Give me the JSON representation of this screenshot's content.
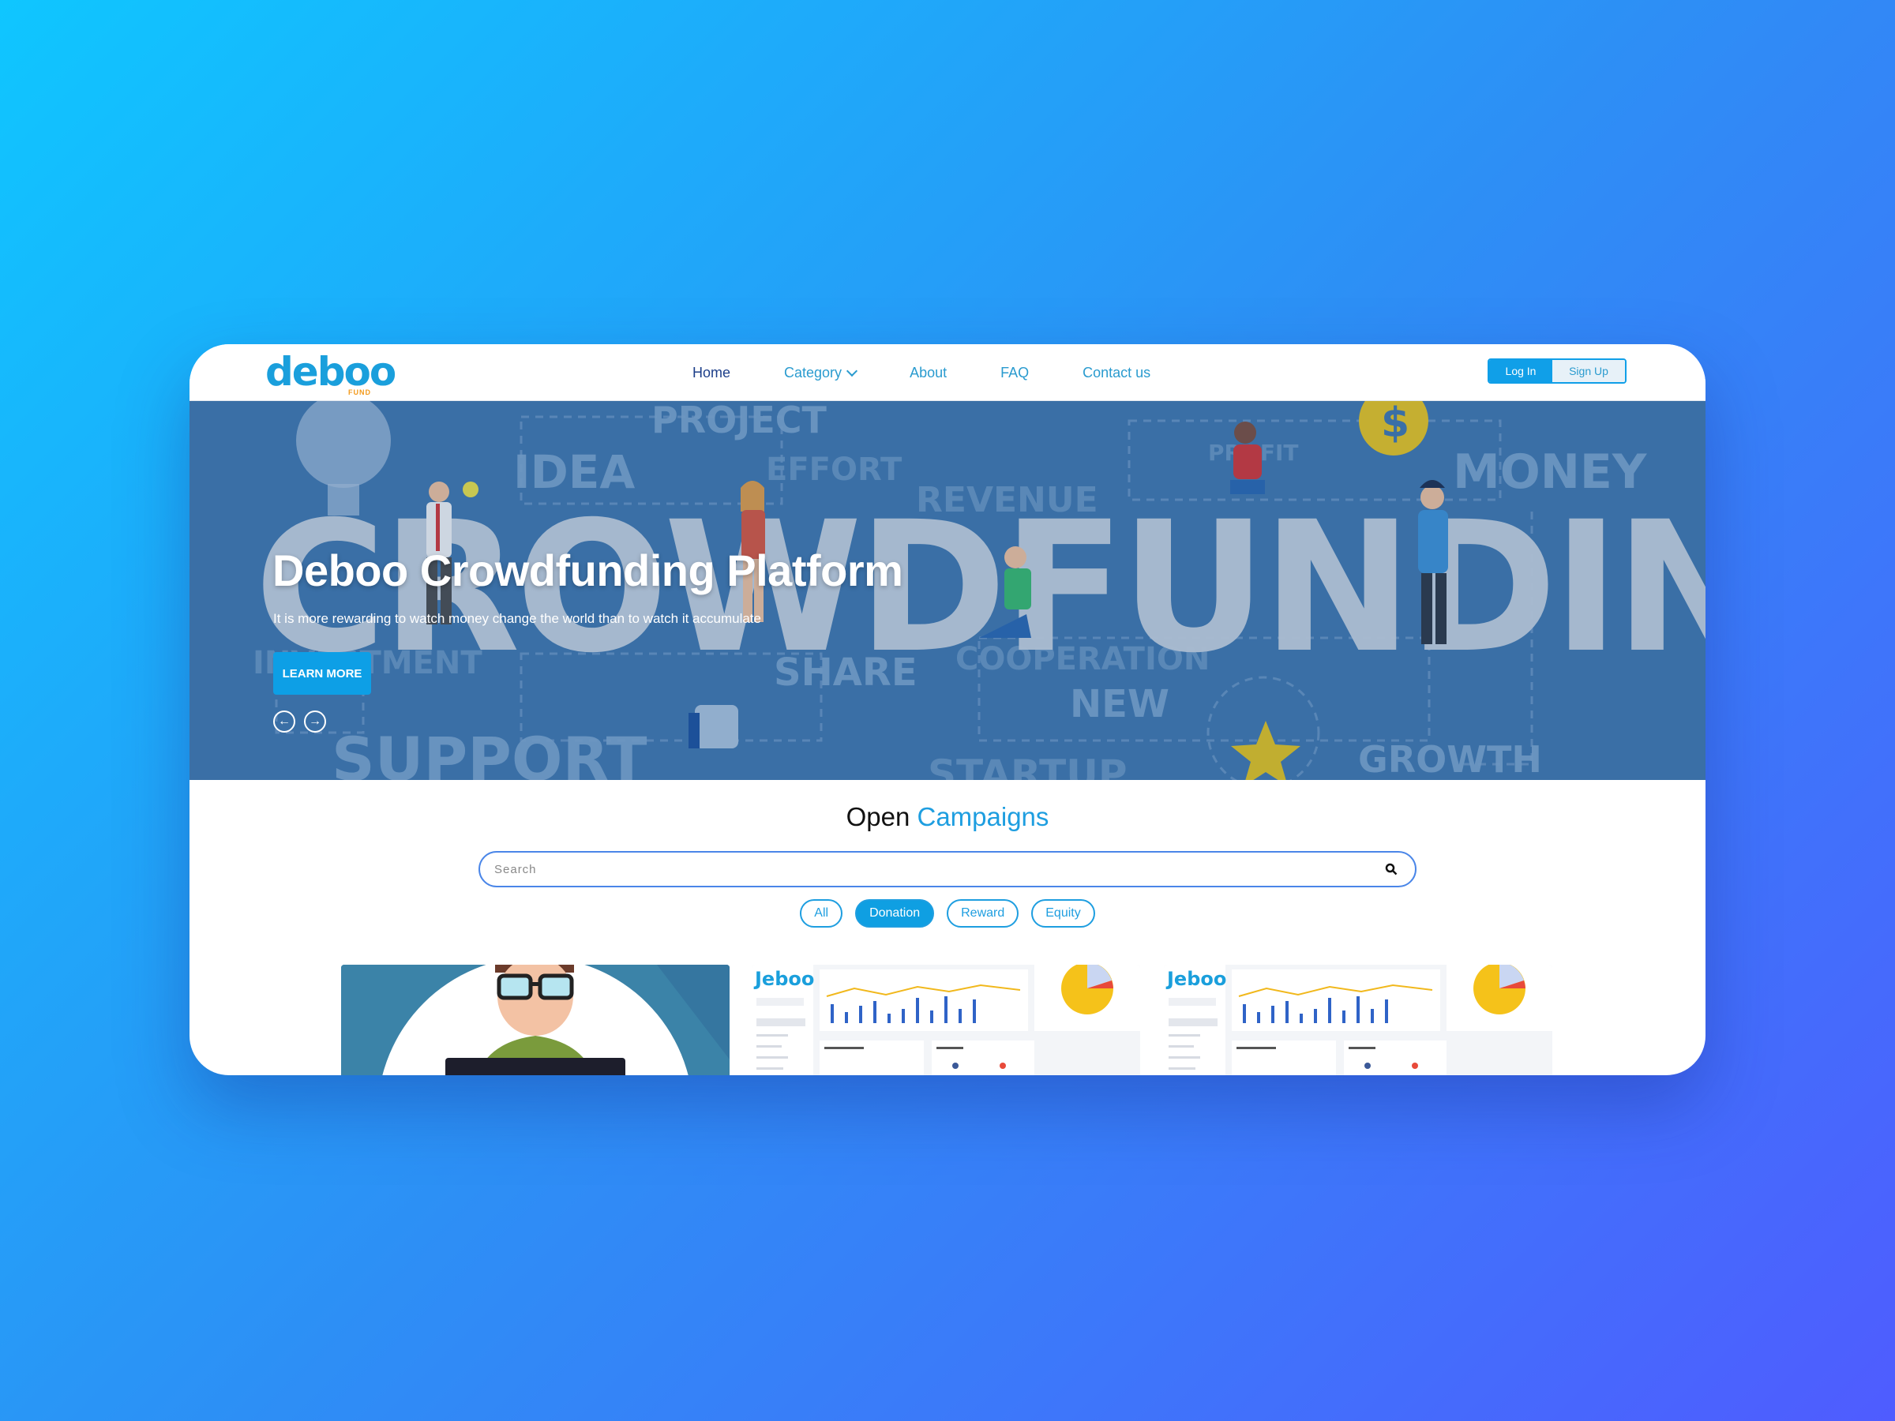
{
  "logo": {
    "text": "deboo",
    "sub": "FUND"
  },
  "nav": {
    "items": [
      {
        "label": "Home"
      },
      {
        "label": "Category"
      },
      {
        "label": "About"
      },
      {
        "label": "FAQ"
      },
      {
        "label": "Contact us"
      }
    ],
    "login": "Log In",
    "signup": "Sign Up"
  },
  "hero": {
    "title": "Deboo Crowdfunding Platform",
    "subtitle": "It is more rewarding to watch money change the world than to watch it accumulate",
    "cta": "LEARN MORE",
    "bg_words": [
      "CROWDFUNDING",
      "PROJECT",
      "IDEA",
      "EFFORT",
      "REVENUE",
      "MONEY",
      "SHARE",
      "SUPPORT",
      "NEW",
      "STARTUP",
      "GROWTH",
      "COOPERATION",
      "INVESTMENT",
      "PROFIT"
    ]
  },
  "campaigns": {
    "title_a": "Open",
    "title_b": "Campaigns",
    "search_placeholder": "Search",
    "filters": [
      {
        "label": "All",
        "active": false
      },
      {
        "label": "Donation",
        "active": true
      },
      {
        "label": "Reward",
        "active": false
      },
      {
        "label": "Equity",
        "active": false
      }
    ]
  },
  "colors": {
    "accent": "#1e9ee0",
    "nav_active": "#1d3f8a",
    "hero": "#3d73a8"
  }
}
